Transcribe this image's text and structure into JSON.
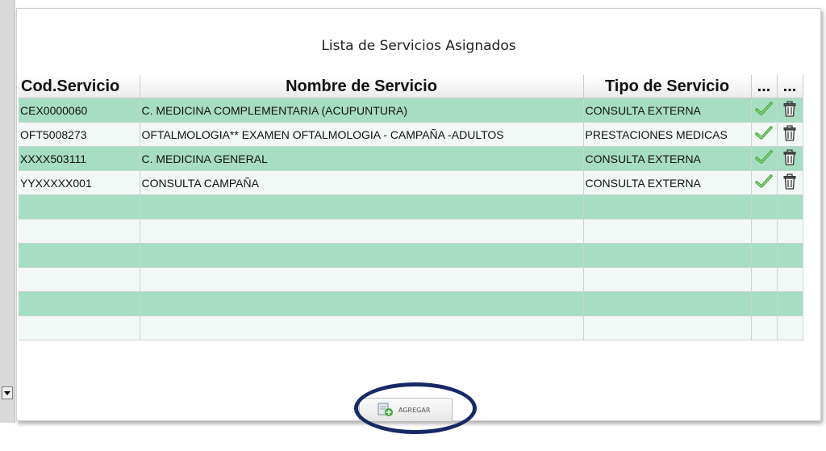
{
  "panel": {
    "title": "Lista de Servicios Asignados"
  },
  "table": {
    "headers": [
      "Cod.Servicio",
      "Nombre de Servicio",
      "Tipo de Servicio",
      "...",
      "..."
    ],
    "rows": [
      {
        "code": "CEX0000060",
        "name": "C. MEDICINA COMPLEMENTARIA (ACUPUNTURA)",
        "type": "CONSULTA EXTERNA",
        "actions": [
          "check-icon",
          "trash-icon"
        ]
      },
      {
        "code": "OFT5008273",
        "name": "OFTALMOLOGIA** EXAMEN OFTALMOLOGIA - CAMPAÑA -ADULTOS",
        "type": "PRESTACIONES MEDICAS",
        "actions": [
          "check-icon",
          "trash-icon"
        ]
      },
      {
        "code": "XXXX503111",
        "name": "C. MEDICINA GENERAL",
        "type": "CONSULTA EXTERNA",
        "actions": [
          "check-icon",
          "trash-icon"
        ]
      },
      {
        "code": "YYXXXXX001",
        "name": "CONSULTA CAMPAÑA",
        "type": "CONSULTA EXTERNA",
        "actions": [
          "check-icon",
          "trash-icon"
        ]
      }
    ],
    "empty_row_count": 6
  },
  "add_button": {
    "label": "AGREGAR",
    "icon": "add-document-icon"
  },
  "colors": {
    "row_odd": "#a7ddc3",
    "row_even": "#f2f8f6",
    "highlight_ring": "#162a66",
    "check_green": "#3fa535"
  }
}
